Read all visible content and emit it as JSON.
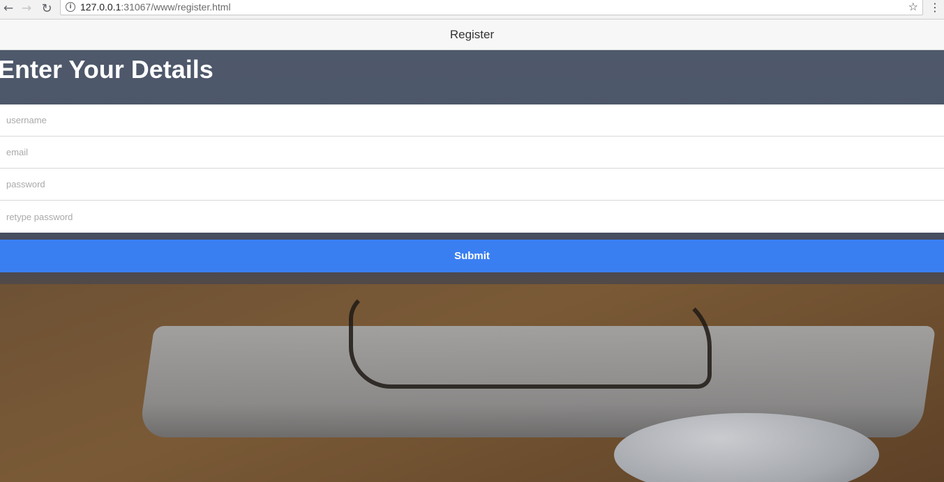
{
  "browser": {
    "url_host": "127.0.0.1",
    "url_rest": ":31067/www/register.html",
    "back_icon": "←",
    "forward_icon": "→",
    "reload_icon": "↻",
    "info_icon": "i",
    "star_icon": "☆",
    "menu_icon": "⋮"
  },
  "header": {
    "title": "Register"
  },
  "main": {
    "heading": "Enter Your Details",
    "form": {
      "username_placeholder": "username",
      "email_placeholder": "email",
      "password_placeholder": "password",
      "retype_password_placeholder": "retype password",
      "submit_label": "Submit"
    }
  },
  "colors": {
    "submit_button": "#3a7ff2",
    "top_bar": "#f7f7f7",
    "heading_text": "#ffffff"
  }
}
